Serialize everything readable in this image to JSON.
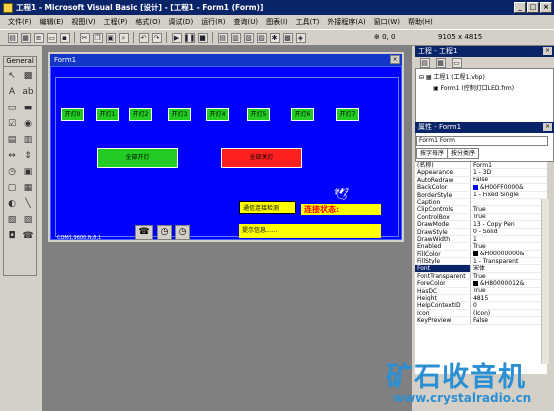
{
  "titlebar": {
    "title": "工程1 - Microsoft Visual Basic [设计] - [工程1 - Form1 (Form)]"
  },
  "menu": {
    "items": [
      "文件(F)",
      "编辑(E)",
      "视图(V)",
      "工程(P)",
      "格式(O)",
      "调试(D)",
      "运行(R)",
      "查询(U)",
      "图表(I)",
      "工具(T)",
      "外接程序(A)",
      "窗口(W)",
      "帮助(H)"
    ]
  },
  "toolbar": {
    "coords": "9105 x 4815"
  },
  "toolbox": {
    "caption": "General"
  },
  "form": {
    "caption": "Form1",
    "lamps": [
      "开灯0",
      "开灯1",
      "开灯2",
      "开灯3",
      "开灯4",
      "开灯5",
      "开灯6",
      "开灯7"
    ],
    "all_on": "全部开灯",
    "all_off": "全部关灯",
    "check_btn": "通信连接检测",
    "conn_label": "连接状态:",
    "status_text": "提示信息......",
    "com_settings": "COM1,9600,N,8,1"
  },
  "project": {
    "caption": "工程 - 工程1",
    "root": "工程1 (工程1.vbp)",
    "child": "Form1 (控制灯口LED.frm)"
  },
  "properties": {
    "caption": "属性 - Form1",
    "object": "Form1 Form",
    "tabs": [
      "按字母序",
      "按分类序"
    ],
    "rows": [
      {
        "k": "(名称)",
        "v": "Form1"
      },
      {
        "k": "Appearance",
        "v": "1 - 3D"
      },
      {
        "k": "AutoRedraw",
        "v": "False"
      },
      {
        "k": "BackColor",
        "v": "&H00FF0000&",
        "c": "#0000ff"
      },
      {
        "k": "BorderStyle",
        "v": "1 - Fixed Single"
      },
      {
        "k": "Caption",
        "v": ""
      },
      {
        "k": "ClipControls",
        "v": "True"
      },
      {
        "k": "ControlBox",
        "v": "True"
      },
      {
        "k": "DrawMode",
        "v": "13 - Copy Pen"
      },
      {
        "k": "DrawStyle",
        "v": "0 - Solid"
      },
      {
        "k": "DrawWidth",
        "v": "1"
      },
      {
        "k": "Enabled",
        "v": "True"
      },
      {
        "k": "FillColor",
        "v": "&H00000000&",
        "c": "#000000"
      },
      {
        "k": "FillStyle",
        "v": "1 - Transparent"
      },
      {
        "k": "Font",
        "v": "宋体",
        "sel": true
      },
      {
        "k": "FontTransparent",
        "v": "True"
      },
      {
        "k": "ForeColor",
        "v": "&H80000012&",
        "c": "#000000"
      },
      {
        "k": "HasDC",
        "v": "True"
      },
      {
        "k": "Height",
        "v": "4815"
      },
      {
        "k": "HelpContextID",
        "v": "0"
      },
      {
        "k": "Icon",
        "v": "(Icon)"
      },
      {
        "k": "KeyPreview",
        "v": "False"
      }
    ]
  },
  "watermark": {
    "text": "矿石收音机",
    "url": "www.crystalradio.cn"
  },
  "colors": {
    "titlebar": "#0a246a",
    "form_bg": "#0000ff",
    "lamp_green": "#22cc22",
    "red_btn": "#ff2020",
    "yellow": "#ffff00",
    "chrome": "#d4d0c8"
  }
}
